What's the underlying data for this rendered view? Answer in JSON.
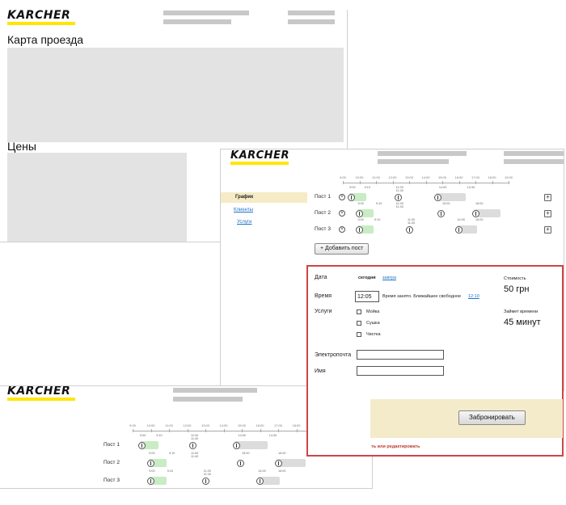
{
  "brand": {
    "logo_text": "KÄRCHER",
    "logo_color": "#ffe600"
  },
  "panel_a": {
    "map_title": "Карта проезда",
    "prices_title": "Цены"
  },
  "nav": {
    "items": [
      {
        "label": "График"
      },
      {
        "label": "Клиенты"
      },
      {
        "label": "Услуги"
      }
    ]
  },
  "schedule": {
    "ticks": [
      "9:00",
      "10:00",
      "11:00",
      "12:00",
      "13:00",
      "14:00",
      "15:00",
      "16:00",
      "17:00",
      "18:00",
      "19:00"
    ],
    "posts": [
      {
        "label": "Пост 1",
        "times": [
          "9:00",
          "9:10",
          "11:00",
          "11:40",
          "14:00",
          "14:30"
        ]
      },
      {
        "label": "Пост 2",
        "times": [
          "9:00",
          "9:10",
          "11:00",
          "11:40",
          "15:00",
          "16:00"
        ]
      },
      {
        "label": "Пост 3",
        "times": [
          "9:00",
          "9:10",
          "11:00",
          "11:40",
          "14:00",
          "16:00"
        ]
      }
    ],
    "add_post_label": "+ Добавить пост",
    "plus_label": "+",
    "remove_label": "×"
  },
  "booking": {
    "date_label": "Дата",
    "today": "сегодня",
    "tomorrow": "завтра",
    "time_label": "Время",
    "time_value": "12:05",
    "time_busy_note": "Время занято. Ближайшее свободное",
    "next_free": "12:10",
    "services_label": "Услуги",
    "services": [
      "Мойка",
      "Сушка",
      "Чистка"
    ],
    "cost_label": "Стоимость",
    "cost_value": "50 грн",
    "duration_label": "Займет времени",
    "duration_value": "45 минут",
    "email_label": "Электропочта",
    "name_label": "Имя",
    "submit_label": "Забронировать",
    "footer_note": "ть или редактировать",
    "border_color": "#d04545"
  }
}
